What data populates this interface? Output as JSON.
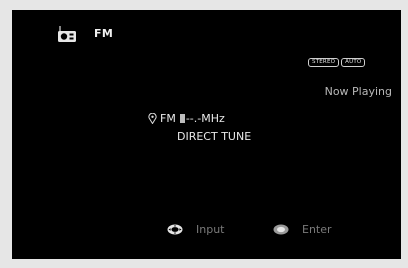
{
  "source": {
    "icon": "radio-icon",
    "label": "FM"
  },
  "badges": [
    "STEREO",
    "AUTO"
  ],
  "status": "Now Playing",
  "tuner": {
    "band": "FM",
    "frequency": "--.-MHz",
    "mode": "DIRECT TUNE",
    "preset_icon": "map-pin-icon"
  },
  "hints": {
    "input_label": "Input",
    "enter_label": "Enter"
  },
  "colors": {
    "background": "#000000",
    "text": "#dcdcdc",
    "hint_text": "#7a7a7a"
  }
}
